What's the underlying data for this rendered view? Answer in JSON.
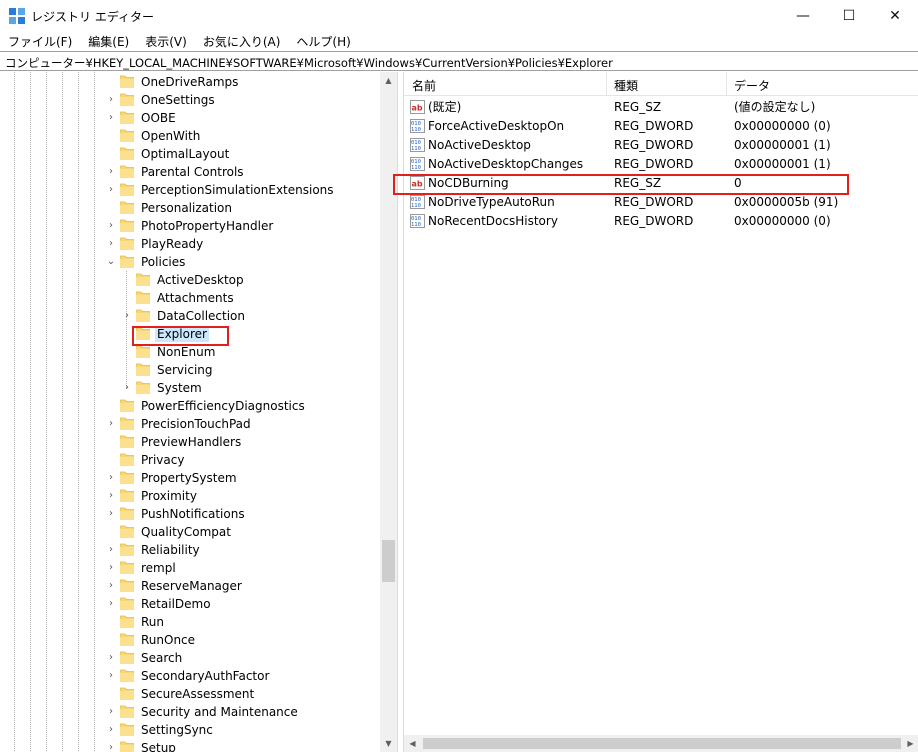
{
  "window": {
    "title": "レジストリ エディター",
    "minimize_glyph": "—",
    "maximize_glyph": "☐",
    "close_glyph": "✕"
  },
  "menu": [
    "ファイル(F)",
    "編集(E)",
    "表示(V)",
    "お気に入り(A)",
    "ヘルプ(H)"
  ],
  "address": "コンピューター¥HKEY_LOCAL_MACHINE¥SOFTWARE¥Microsoft¥Windows¥CurrentVersion¥Policies¥Explorer",
  "tree": [
    {
      "label": "OneDriveRamps",
      "level": 0,
      "chevron": "none"
    },
    {
      "label": "OneSettings",
      "level": 0,
      "chevron": "collapsed"
    },
    {
      "label": "OOBE",
      "level": 0,
      "chevron": "collapsed"
    },
    {
      "label": "OpenWith",
      "level": 0,
      "chevron": "none"
    },
    {
      "label": "OptimalLayout",
      "level": 0,
      "chevron": "none"
    },
    {
      "label": "Parental Controls",
      "level": 0,
      "chevron": "collapsed"
    },
    {
      "label": "PerceptionSimulationExtensions",
      "level": 0,
      "chevron": "collapsed"
    },
    {
      "label": "Personalization",
      "level": 0,
      "chevron": "none"
    },
    {
      "label": "PhotoPropertyHandler",
      "level": 0,
      "chevron": "collapsed"
    },
    {
      "label": "PlayReady",
      "level": 0,
      "chevron": "collapsed"
    },
    {
      "label": "Policies",
      "level": 0,
      "chevron": "expanded"
    },
    {
      "label": "ActiveDesktop",
      "level": 1,
      "chevron": "none"
    },
    {
      "label": "Attachments",
      "level": 1,
      "chevron": "none"
    },
    {
      "label": "DataCollection",
      "level": 1,
      "chevron": "collapsed"
    },
    {
      "label": "Explorer",
      "level": 1,
      "chevron": "none",
      "selected": true
    },
    {
      "label": "NonEnum",
      "level": 1,
      "chevron": "none"
    },
    {
      "label": "Servicing",
      "level": 1,
      "chevron": "none"
    },
    {
      "label": "System",
      "level": 1,
      "chevron": "collapsed"
    },
    {
      "label": "PowerEfficiencyDiagnostics",
      "level": 0,
      "chevron": "none"
    },
    {
      "label": "PrecisionTouchPad",
      "level": 0,
      "chevron": "collapsed"
    },
    {
      "label": "PreviewHandlers",
      "level": 0,
      "chevron": "none"
    },
    {
      "label": "Privacy",
      "level": 0,
      "chevron": "none"
    },
    {
      "label": "PropertySystem",
      "level": 0,
      "chevron": "collapsed"
    },
    {
      "label": "Proximity",
      "level": 0,
      "chevron": "collapsed"
    },
    {
      "label": "PushNotifications",
      "level": 0,
      "chevron": "collapsed"
    },
    {
      "label": "QualityCompat",
      "level": 0,
      "chevron": "none"
    },
    {
      "label": "Reliability",
      "level": 0,
      "chevron": "collapsed"
    },
    {
      "label": "rempl",
      "level": 0,
      "chevron": "collapsed"
    },
    {
      "label": "ReserveManager",
      "level": 0,
      "chevron": "collapsed"
    },
    {
      "label": "RetailDemo",
      "level": 0,
      "chevron": "collapsed"
    },
    {
      "label": "Run",
      "level": 0,
      "chevron": "none"
    },
    {
      "label": "RunOnce",
      "level": 0,
      "chevron": "none"
    },
    {
      "label": "Search",
      "level": 0,
      "chevron": "collapsed"
    },
    {
      "label": "SecondaryAuthFactor",
      "level": 0,
      "chevron": "collapsed"
    },
    {
      "label": "SecureAssessment",
      "level": 0,
      "chevron": "none"
    },
    {
      "label": "Security and Maintenance",
      "level": 0,
      "chevron": "collapsed"
    },
    {
      "label": "SettingSync",
      "level": 0,
      "chevron": "collapsed"
    },
    {
      "label": "Setup",
      "level": 0,
      "chevron": "collapsed"
    }
  ],
  "list": {
    "columns": [
      "名前",
      "種類",
      "データ"
    ],
    "rows": [
      {
        "icon": "string-value-icon",
        "name": "(既定)",
        "type": "REG_SZ",
        "data": "(値の設定なし)"
      },
      {
        "icon": "binary-value-icon",
        "name": "ForceActiveDesktopOn",
        "type": "REG_DWORD",
        "data": "0x00000000 (0)"
      },
      {
        "icon": "binary-value-icon",
        "name": "NoActiveDesktop",
        "type": "REG_DWORD",
        "data": "0x00000001 (1)"
      },
      {
        "icon": "binary-value-icon",
        "name": "NoActiveDesktopChanges",
        "type": "REG_DWORD",
        "data": "0x00000001 (1)"
      },
      {
        "icon": "string-value-icon",
        "name": "NoCDBurning",
        "type": "REG_SZ",
        "data": "0",
        "highlighted": true
      },
      {
        "icon": "binary-value-icon",
        "name": "NoDriveTypeAutoRun",
        "type": "REG_DWORD",
        "data": "0x0000005b (91)"
      },
      {
        "icon": "binary-value-icon",
        "name": "NoRecentDocsHistory",
        "type": "REG_DWORD",
        "data": "0x00000000 (0)"
      }
    ]
  },
  "colors": {
    "highlight_box": "#e0201b",
    "selection": "#cce8ff",
    "folder": "#f8d775"
  }
}
